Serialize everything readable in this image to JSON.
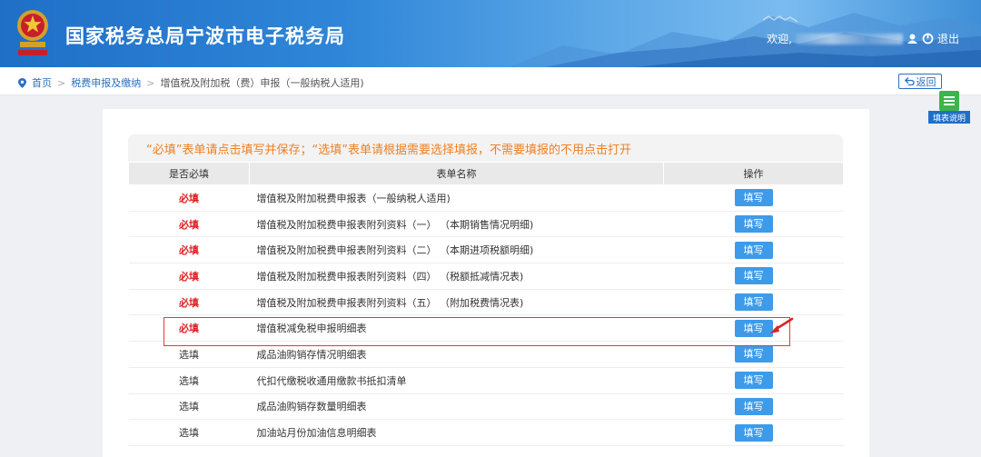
{
  "header": {
    "site_title": "国家税务总局宁波市电子税务局",
    "welcome": "欢迎,",
    "logout": "退出"
  },
  "breadcrumb": {
    "home": "首页",
    "level1": "税费申报及缴纳",
    "level2": "增值税及附加税（费）申报（一般纳税人适用)",
    "sep": ">"
  },
  "back_label": "返回",
  "side_help_label": "填表说明",
  "notice": "“必填”表单请点击填写并保存；“选填”表单请根据需要选择填报，不需要填报的不用点击打开",
  "table": {
    "headers": [
      "是否必填",
      "表单名称",
      "操作"
    ],
    "fill_label": "填写",
    "rows": [
      {
        "req": "必填",
        "name": "增值税及附加税费申报表（一般纳税人适用)"
      },
      {
        "req": "必填",
        "name": "增值税及附加税费申报表附列资料（一）  （本期销售情况明细)"
      },
      {
        "req": "必填",
        "name": "增值税及附加税费申报表附列资料（二）  （本期进项税额明细)"
      },
      {
        "req": "必填",
        "name": "增值税及附加税费申报表附列资料（四）  （税额抵减情况表)"
      },
      {
        "req": "必填",
        "name": "增值税及附加税费申报表附列资料（五）  （附加税费情况表)"
      },
      {
        "req": "必填",
        "name": "增值税减免税申报明细表"
      },
      {
        "req": "选填",
        "name": "成品油购销存情况明细表"
      },
      {
        "req": "选填",
        "name": "代扣代缴税收通用缴款书抵扣清单"
      },
      {
        "req": "选填",
        "name": "成品油购销存数量明细表"
      },
      {
        "req": "选填",
        "name": "加油站月份加油信息明细表"
      }
    ]
  },
  "colors": {
    "header_blue": "#1f6fc7",
    "required_red": "#e02020",
    "notice_orange": "#f08020",
    "button_blue": "#3d9be9",
    "highlight_red": "#e23b3b"
  }
}
